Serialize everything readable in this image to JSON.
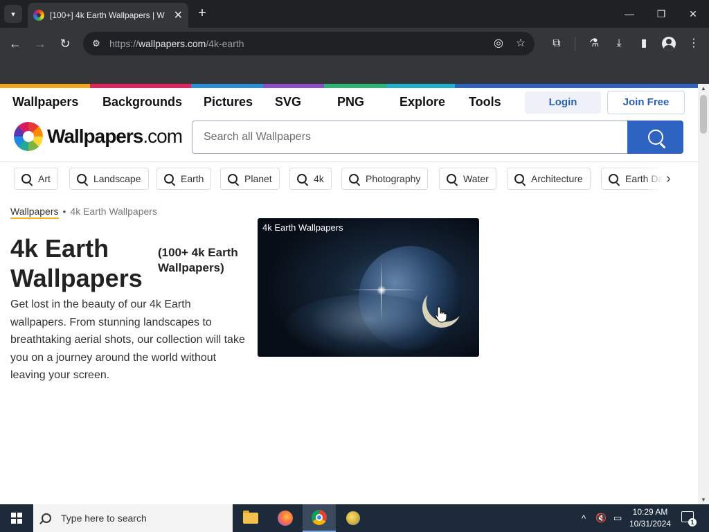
{
  "browser": {
    "tab_title": "[100+] 4k Earth Wallpapers | W",
    "url_prefix": "https://",
    "url_host": "wallpapers.com",
    "url_path": "/4k-earth"
  },
  "site": {
    "nav": [
      "Wallpapers",
      "Backgrounds",
      "Pictures",
      "SVG",
      "PNG",
      "Explore",
      "Tools"
    ],
    "login_label": "Login",
    "join_label": "Join Free",
    "logo_text_main": "Wallpapers",
    "logo_text_tld": ".com",
    "search_placeholder": "Search all Wallpapers",
    "stripe_colors": [
      "#f2a619",
      "#e0245e",
      "#e0245e",
      "#2a8fd6",
      "#8a4fc7",
      "#2bb673",
      "#20b2c9",
      "#2f63c2"
    ]
  },
  "chips": [
    "Art",
    "Landscape",
    "Earth",
    "Planet",
    "4k",
    "Photography",
    "Water",
    "Architecture",
    "Earth Day"
  ],
  "breadcrumb": {
    "home": "Wallpapers",
    "separator": "•",
    "current": "4k Earth Wallpapers"
  },
  "page": {
    "title": "4k Earth Wallpapers",
    "count_label": "(100+ 4k Earth Wallpapers)",
    "description": "Get lost in the beauty of our 4k Earth wallpapers. From stunning landscapes to breathtaking aerial shots, our collection will take you on a journey around the world without leaving your screen."
  },
  "card": {
    "title": "4k Earth Wallpapers"
  },
  "taskbar": {
    "search_placeholder": "Type here to search",
    "time": "10:29 AM",
    "date": "10/31/2024",
    "notification_count": "1"
  }
}
